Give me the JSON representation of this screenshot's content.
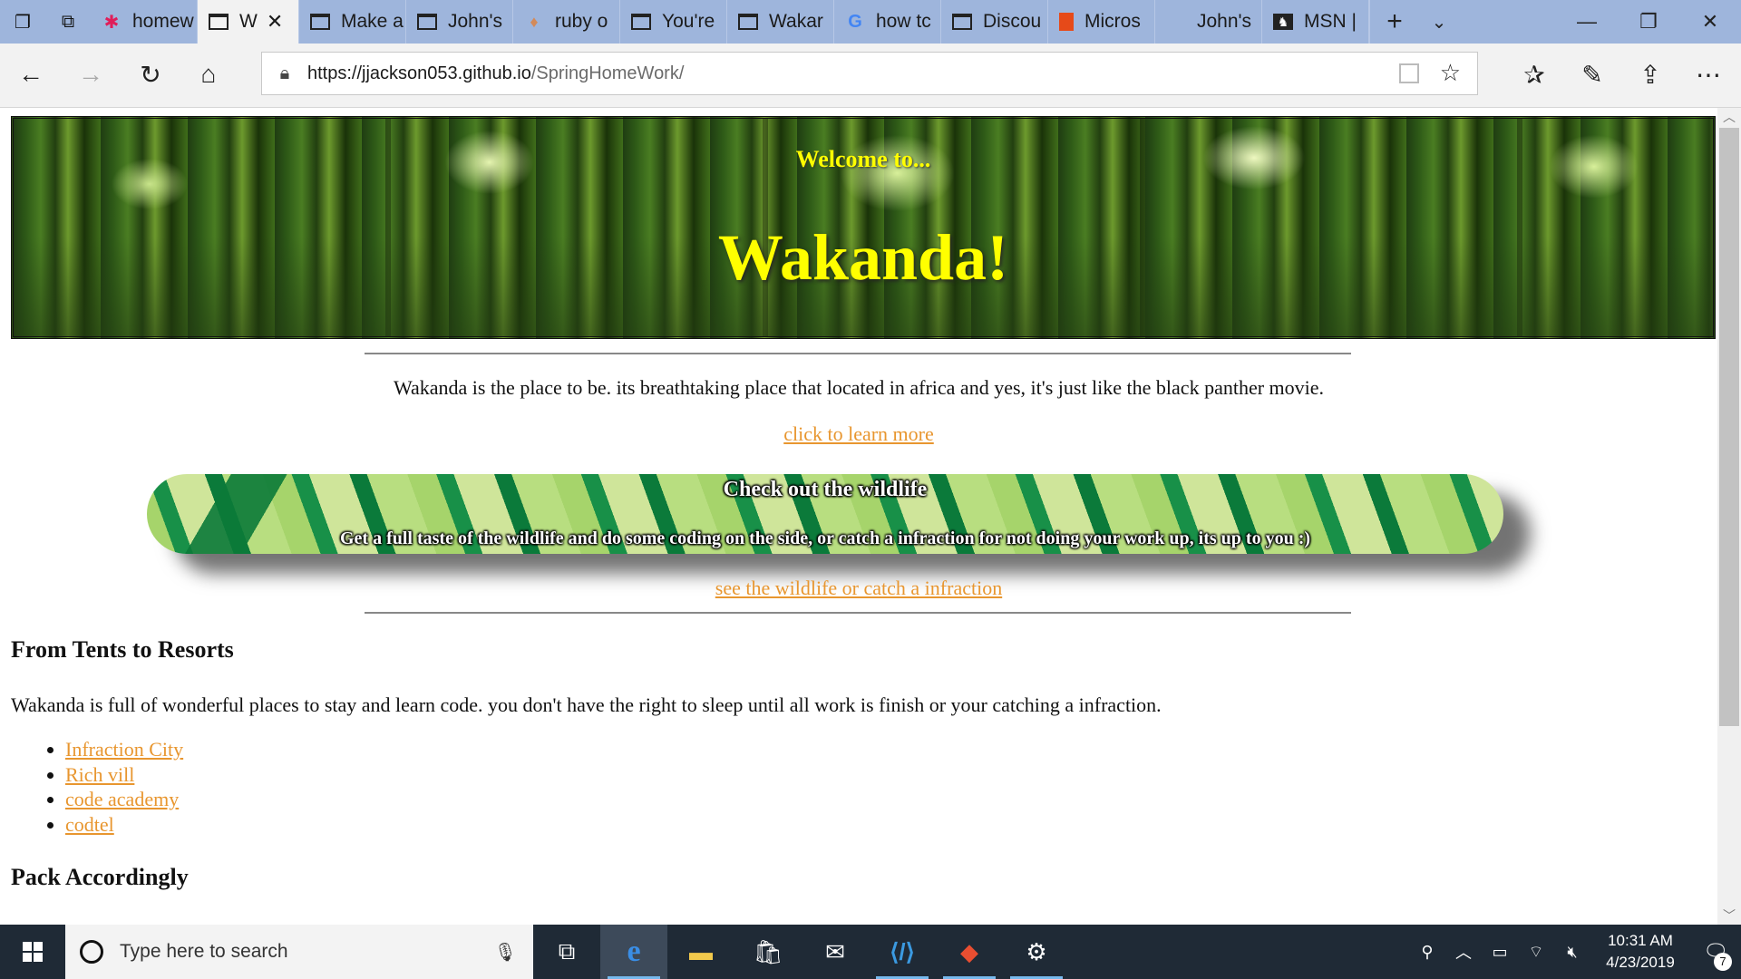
{
  "tabs": [
    {
      "label": "homew",
      "icon": "slack-icon"
    },
    {
      "label": "W",
      "icon": "window-icon",
      "active": true
    },
    {
      "label": "Make a",
      "icon": "codepen-icon"
    },
    {
      "label": "John's",
      "icon": "window-icon"
    },
    {
      "label": "ruby o",
      "icon": "ruby-icon"
    },
    {
      "label": "You're",
      "icon": "window-icon"
    },
    {
      "label": "Wakar",
      "icon": "window-icon"
    },
    {
      "label": "how tc",
      "icon": "google-icon"
    },
    {
      "label": "Discou",
      "icon": "window-icon"
    },
    {
      "label": "Micros",
      "icon": "office-icon"
    },
    {
      "label": "John's",
      "icon": "blank-icon"
    },
    {
      "label": "MSN |",
      "icon": "msn-icon"
    }
  ],
  "address": {
    "scheme_host": "https://jjackson053.github.io",
    "path": "/SpringHomeWork/"
  },
  "page": {
    "welcome": "Welcome to...",
    "title": "Wakanda!",
    "intro": "Wakanda is the place to be. its breathtaking place that located in africa and yes, it's just like the black panther movie.",
    "learn_more": "click to learn more",
    "wildlife_title": "Check out the wildlife",
    "wildlife_sub": "Get a full taste of the wildlife and do some coding on the side, or catch a infraction for not doing your work up, its up to you :)",
    "wildlife_link": "see the wildlife or catch a infraction",
    "tents_heading": "From Tents to Resorts",
    "tents_text": "Wakanda is full of wonderful places to stay and learn code. you don't have the right to sleep until all work is finish or your catching a infraction.",
    "places": [
      "Infraction City",
      "Rich vill",
      "code academy",
      "codtel"
    ],
    "pack_heading": "Pack Accordingly"
  },
  "taskbar": {
    "search_placeholder": "Type here to search",
    "time": "10:31 AM",
    "date": "4/23/2019",
    "notification_count": "7"
  },
  "colors": {
    "tabbar": "#9eb5dc",
    "link": "#e8962f",
    "banner_text": "#ffff00",
    "taskbar": "#1f2a36"
  }
}
